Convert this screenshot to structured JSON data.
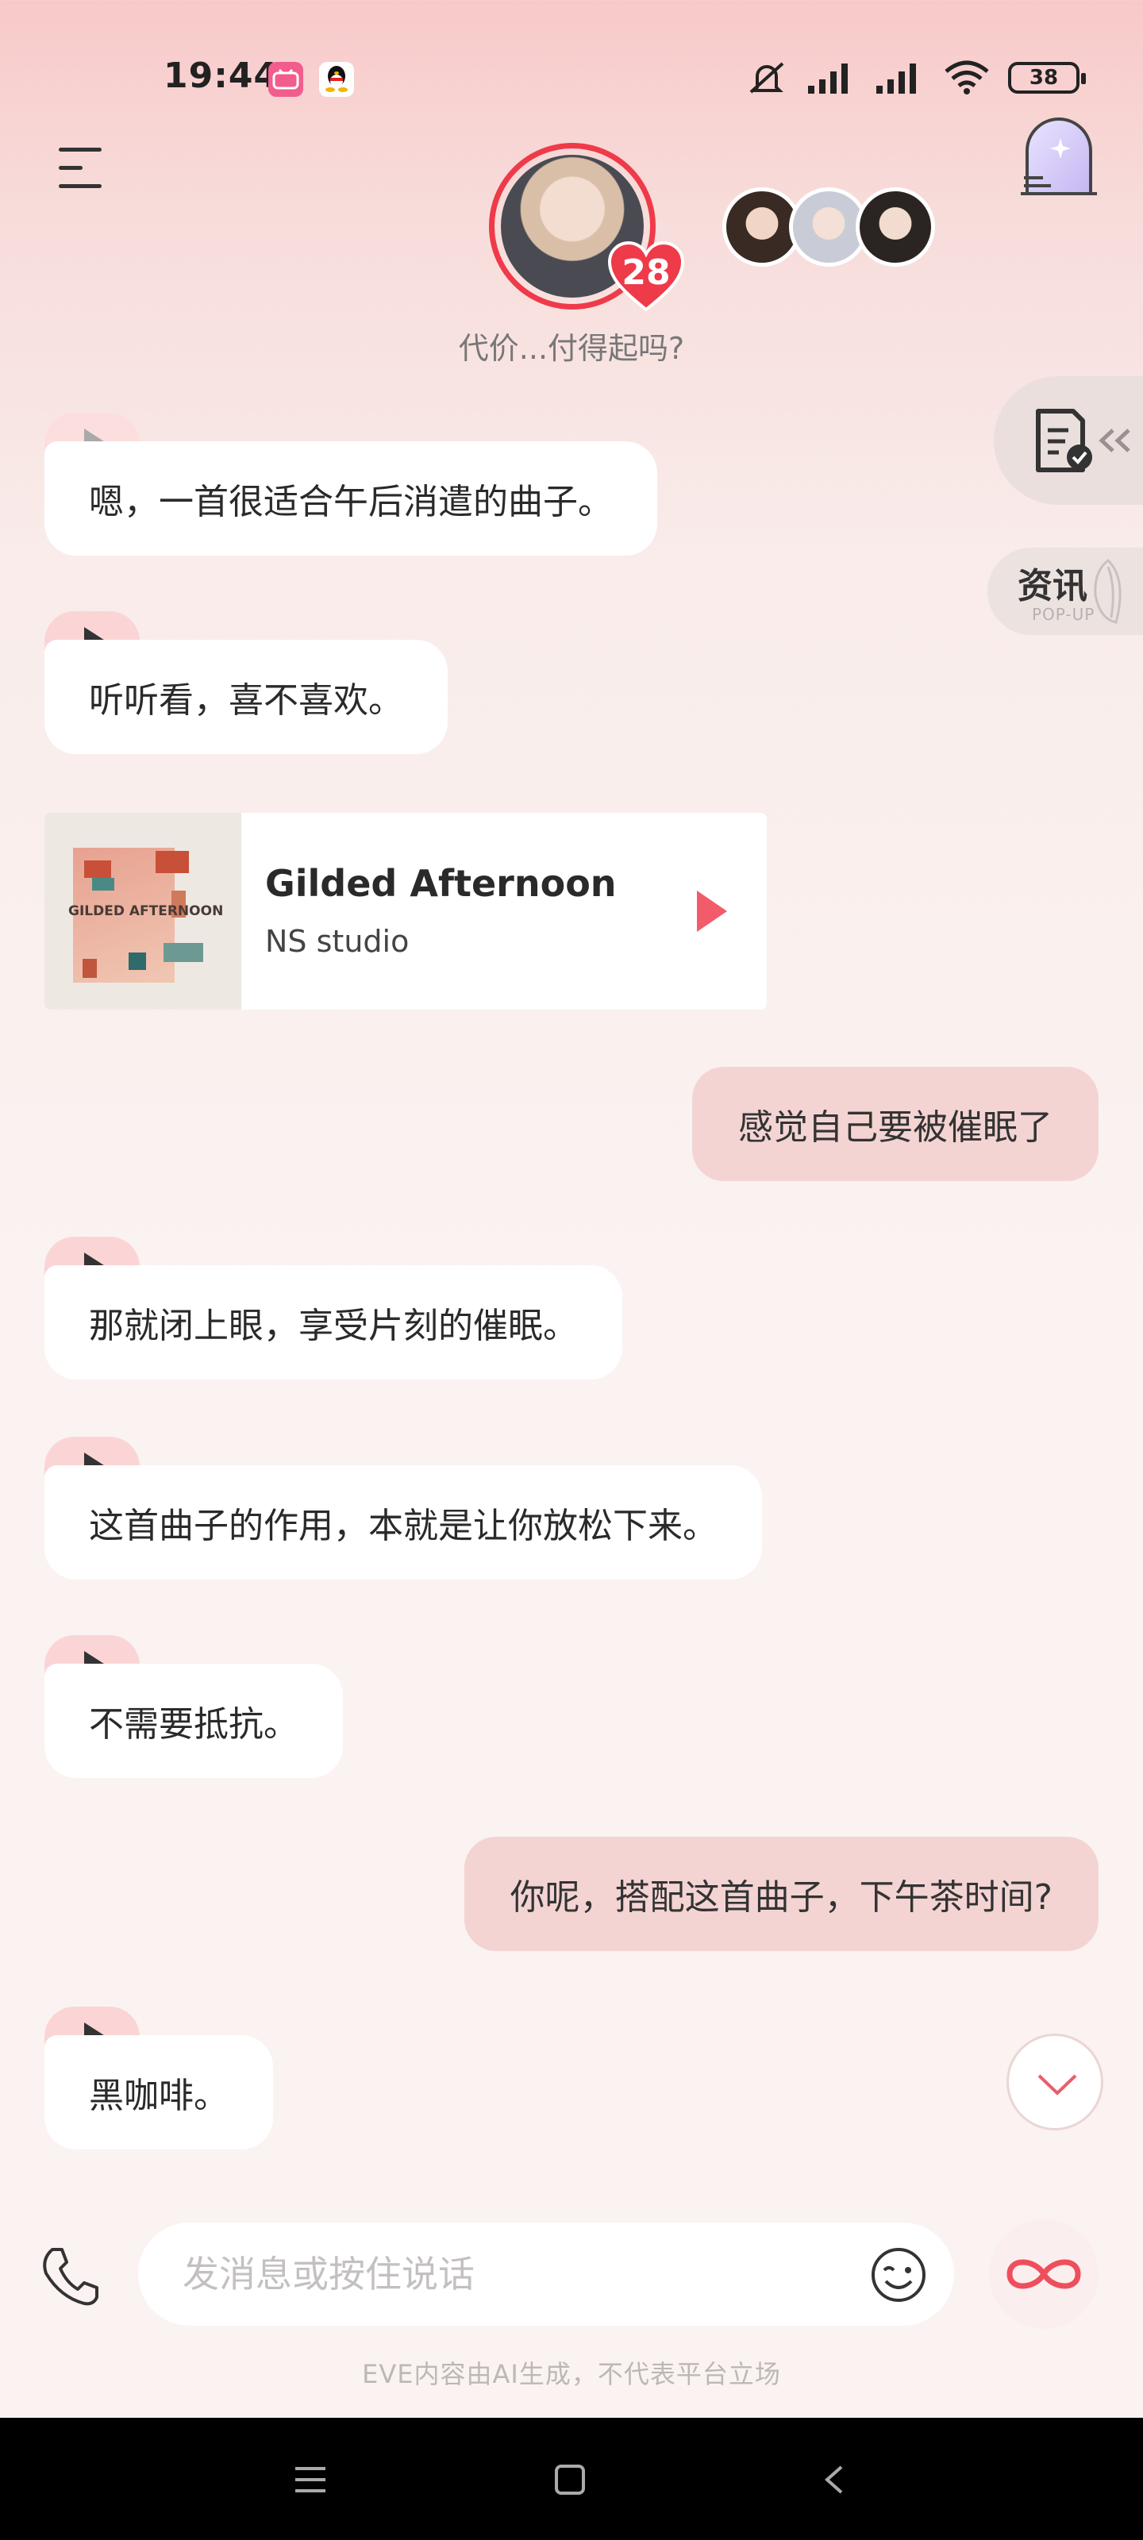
{
  "status_bar": {
    "time": "19:44",
    "battery": "38"
  },
  "header": {
    "affection_count": "28",
    "subtitle": "代价...付得起吗?"
  },
  "side": {
    "news_label": "资讯",
    "news_sub": "POP-UP"
  },
  "messages": [
    {
      "side": "left",
      "text": "嗯，一首很适合午后消遣的曲子。"
    },
    {
      "side": "left",
      "text": "听听看，喜不喜欢。"
    },
    {
      "side": "right",
      "text": "感觉自己要被催眠了"
    },
    {
      "side": "left",
      "text": "那就闭上眼，享受片刻的催眠。"
    },
    {
      "side": "left",
      "text": "这首曲子的作用，本就是让你放松下来。"
    },
    {
      "side": "left",
      "text": "不需要抵抗。"
    },
    {
      "side": "right",
      "text": "你呢，搭配这首曲子，下午茶时间?"
    },
    {
      "side": "left",
      "text": "黑咖啡。"
    }
  ],
  "music_card": {
    "album_text": "GILDED AFTERNOON",
    "title": "Gilded Afternoon",
    "artist": "NS studio"
  },
  "input": {
    "placeholder": "发消息或按住说话",
    "value": ""
  },
  "disclaimer": "EVE内容由AI生成，不代表平台立场",
  "colors": {
    "accent": "#ef3a4a",
    "user_bubble": "#f3d4d3",
    "play_tab": "#fbd5d5",
    "song_play": "#f25c6a"
  }
}
